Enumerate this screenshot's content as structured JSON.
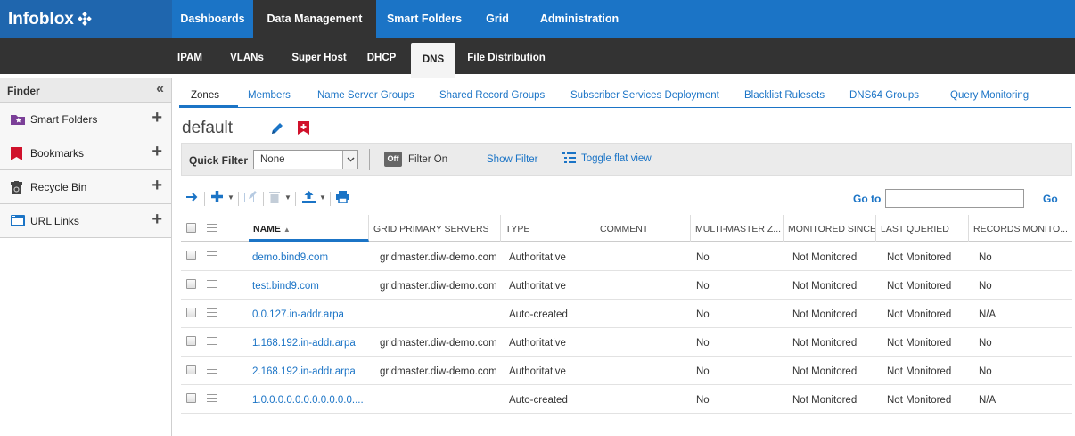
{
  "brand": "Infoblox",
  "top_nav": [
    "Dashboards",
    "Data Management",
    "Smart Folders",
    "Grid",
    "Administration"
  ],
  "sub_nav": [
    "IPAM",
    "VLANs",
    "Super Host",
    "DHCP",
    "DNS",
    "File Distribution"
  ],
  "sidebar": {
    "title": "Finder",
    "items": [
      {
        "label": "Smart Folders",
        "icon": "smart-folder-icon"
      },
      {
        "label": "Bookmarks",
        "icon": "bookmark-icon"
      },
      {
        "label": "Recycle Bin",
        "icon": "recycle-bin-icon"
      },
      {
        "label": "URL Links",
        "icon": "url-link-icon"
      }
    ]
  },
  "dns_tabs": [
    "Zones",
    "Members",
    "Name Server Groups",
    "Shared Record Groups",
    "Subscriber Services Deployment",
    "Blacklist Rulesets",
    "DNS64 Groups",
    "Query Monitoring"
  ],
  "view_title": "default",
  "filter": {
    "label": "Quick Filter",
    "value": "None",
    "toggle": "Off",
    "status": "Filter On",
    "show_filter": "Show Filter",
    "toggle_flat": "Toggle flat view"
  },
  "goto": {
    "label": "Go to",
    "button": "Go",
    "value": ""
  },
  "table": {
    "columns": [
      "NAME",
      "GRID PRIMARY SERVERS",
      "TYPE",
      "COMMENT",
      "MULTI-MASTER Z...",
      "MONITORED SINCE",
      "LAST QUERIED",
      "RECORDS MONITO..."
    ],
    "rows": [
      [
        "demo.bind9.com",
        "gridmaster.diw-demo.com",
        "Authoritative",
        "",
        "No",
        "Not Monitored",
        "Not Monitored",
        "No"
      ],
      [
        "test.bind9.com",
        "gridmaster.diw-demo.com",
        "Authoritative",
        "",
        "No",
        "Not Monitored",
        "Not Monitored",
        "No"
      ],
      [
        "0.0.127.in-addr.arpa",
        "",
        "Auto-created",
        "",
        "No",
        "Not Monitored",
        "Not Monitored",
        "N/A"
      ],
      [
        "1.168.192.in-addr.arpa",
        "gridmaster.diw-demo.com",
        "Authoritative",
        "",
        "No",
        "Not Monitored",
        "Not Monitored",
        "No"
      ],
      [
        "2.168.192.in-addr.arpa",
        "gridmaster.diw-demo.com",
        "Authoritative",
        "",
        "No",
        "Not Monitored",
        "Not Monitored",
        "No"
      ],
      [
        "1.0.0.0.0.0.0.0.0.0.0.0....",
        "",
        "Auto-created",
        "",
        "No",
        "Not Monitored",
        "Not Monitored",
        "N/A"
      ]
    ]
  },
  "colors": {
    "brand_blue": "#1b74c6",
    "dark_bar": "#333333",
    "bookmark_red": "#d0112b"
  }
}
